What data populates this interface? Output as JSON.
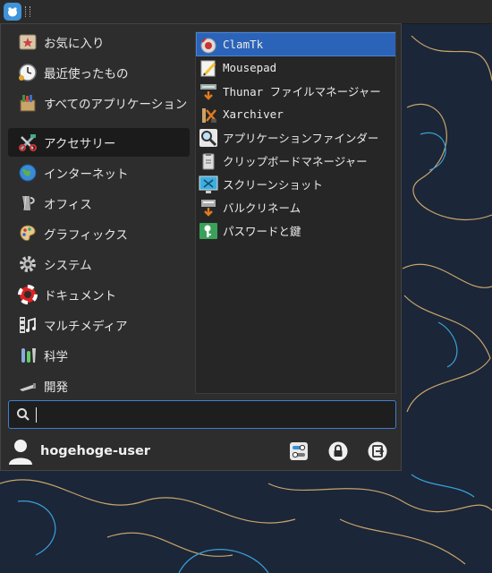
{
  "categories": [
    {
      "label": "お気に入り",
      "icon": "favorites-icon"
    },
    {
      "label": "最近使ったもの",
      "icon": "clock-icon"
    },
    {
      "label": "すべてのアプリケーション",
      "icon": "all-apps-icon"
    },
    {
      "label": "アクセサリー",
      "icon": "accessories-icon"
    },
    {
      "label": "インターネット",
      "icon": "globe-icon"
    },
    {
      "label": "オフィス",
      "icon": "office-icon"
    },
    {
      "label": "グラフィックス",
      "icon": "palette-icon"
    },
    {
      "label": "システム",
      "icon": "gear-icon"
    },
    {
      "label": "ドキュメント",
      "icon": "help-lifebuoy-icon"
    },
    {
      "label": "マルチメディア",
      "icon": "multimedia-icon"
    },
    {
      "label": "科学",
      "icon": "science-icon"
    },
    {
      "label": "開発",
      "icon": "development-icon"
    }
  ],
  "selected_category": "アクセサリー",
  "apps": [
    {
      "label": "ClamTk",
      "icon": "clamtk-icon"
    },
    {
      "label": "Mousepad",
      "icon": "text-editor-icon"
    },
    {
      "label": "Thunar ファイルマネージャー",
      "icon": "file-manager-icon"
    },
    {
      "label": "Xarchiver",
      "icon": "archive-icon"
    },
    {
      "label": "アプリケーションファインダー",
      "icon": "magnifier-icon"
    },
    {
      "label": "クリップボードマネージャー",
      "icon": "clipboard-icon"
    },
    {
      "label": "スクリーンショット",
      "icon": "screenshot-icon"
    },
    {
      "label": "バルクリネーム",
      "icon": "bulk-rename-icon"
    },
    {
      "label": "パスワードと鍵",
      "icon": "key-icon"
    }
  ],
  "selected_app": "ClamTk",
  "search": {
    "value": "",
    "placeholder": ""
  },
  "user": {
    "name": "hogehoge-user"
  },
  "actions": [
    {
      "name": "settings-button",
      "icon": "settings-toggle-icon"
    },
    {
      "name": "lock-screen-button",
      "icon": "lock-icon"
    },
    {
      "name": "logout-button",
      "icon": "logout-icon"
    }
  ],
  "colors": {
    "accent": "#2a63b8",
    "panel": "#2d2d2d",
    "desktop": "#1b2638"
  }
}
